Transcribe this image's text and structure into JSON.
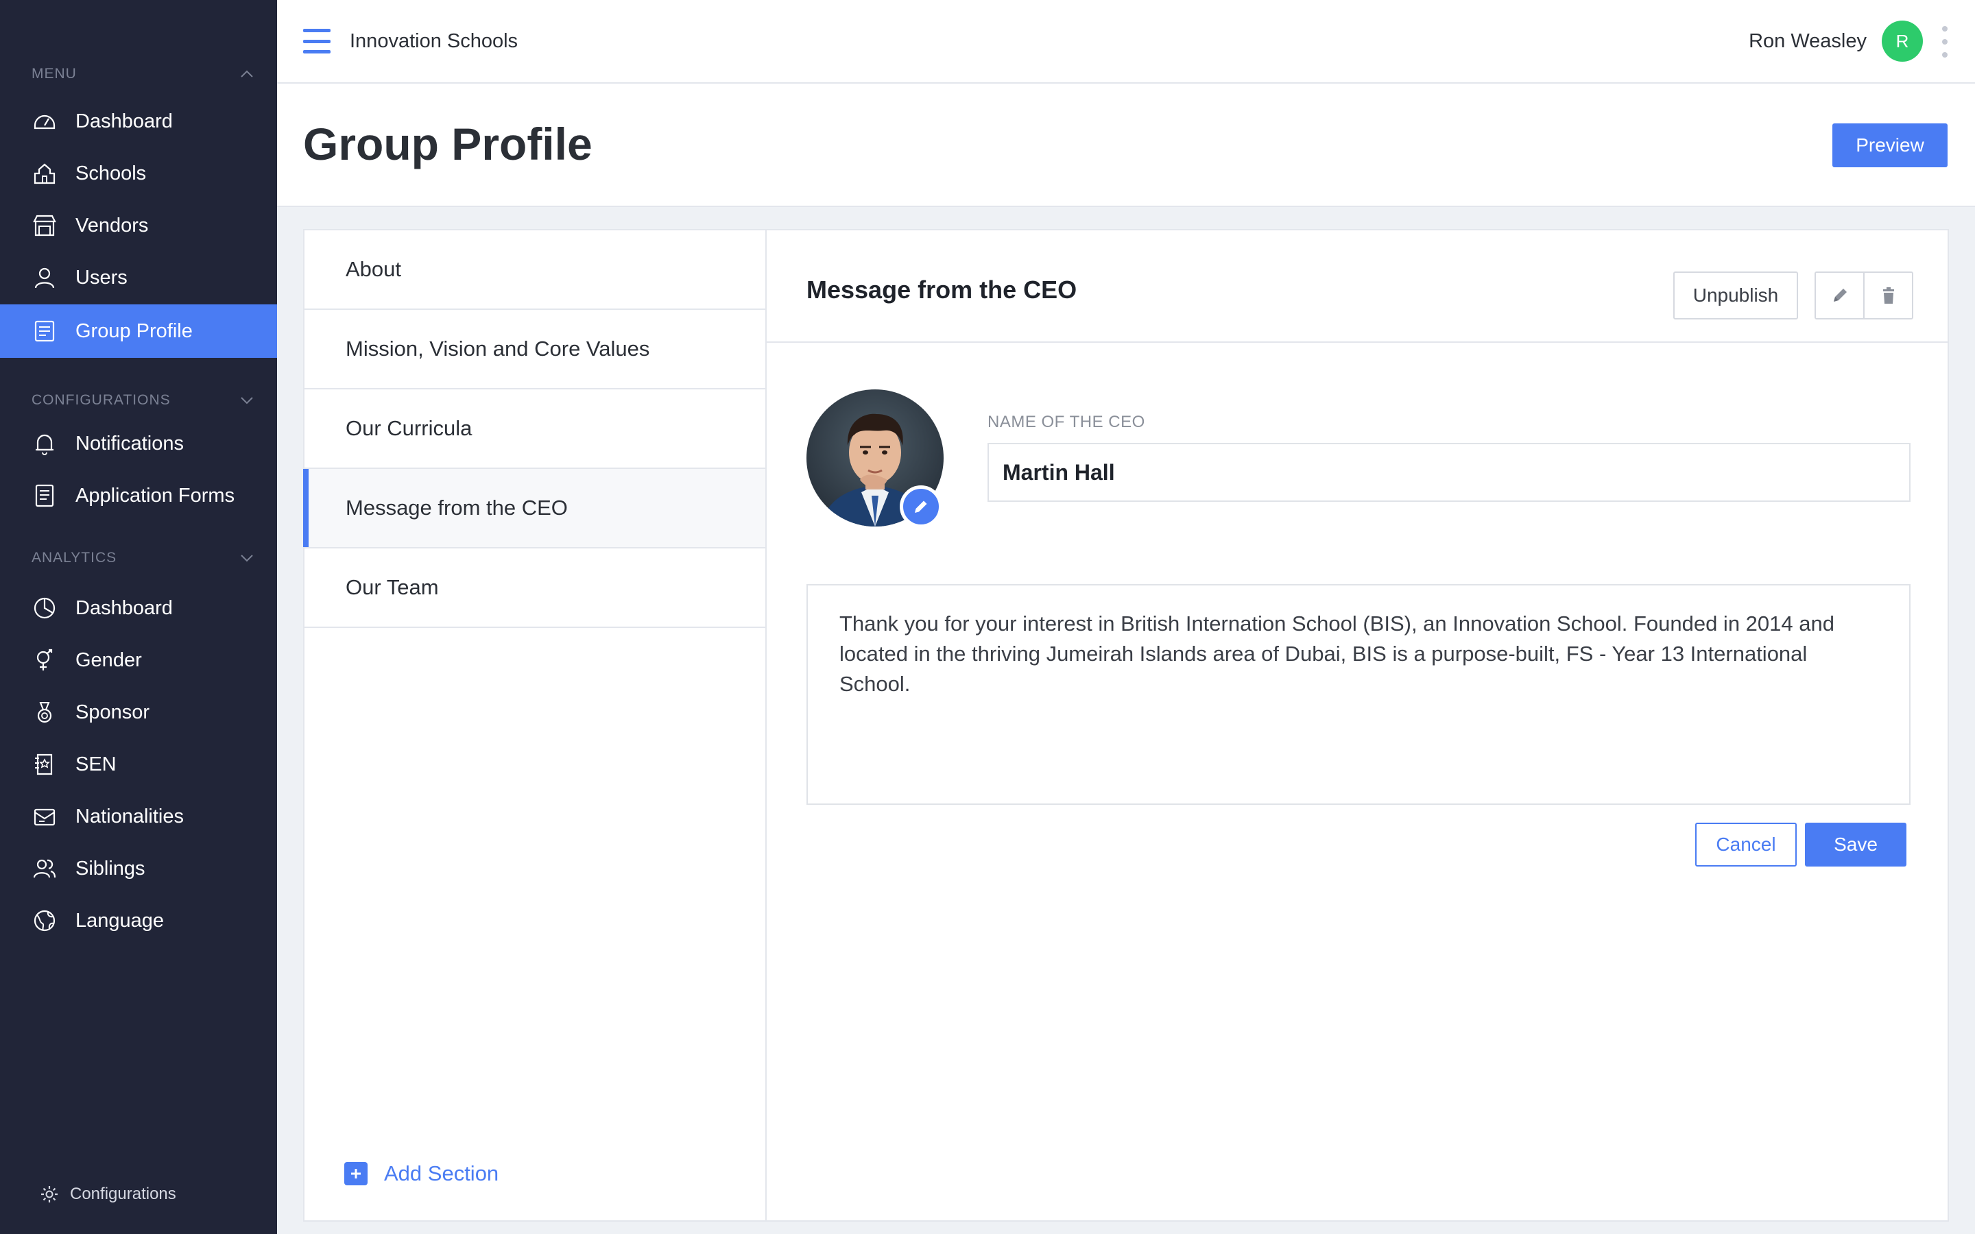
{
  "app": {
    "org_name": "Innovation Schools",
    "user_name": "Ron Weasley",
    "user_initial": "R",
    "accent_color": "#4a7cf3",
    "avatar_color": "#2dcb6b"
  },
  "sidebar": {
    "menu_heading": "MENU",
    "menu_items": [
      {
        "label": "Dashboard",
        "icon": "dashboard-icon"
      },
      {
        "label": "Schools",
        "icon": "school-icon"
      },
      {
        "label": "Vendors",
        "icon": "store-icon"
      },
      {
        "label": "Users",
        "icon": "user-icon"
      },
      {
        "label": "Group Profile",
        "icon": "profile-icon",
        "active": true
      }
    ],
    "config_heading": "CONFIGURATIONS",
    "config_items": [
      {
        "label": "Notifications",
        "icon": "bell-icon"
      },
      {
        "label": "Application Forms",
        "icon": "form-icon"
      }
    ],
    "analytics_heading": "ANALYTICS",
    "analytics_items": [
      {
        "label": "Dashboard",
        "icon": "pie-chart-icon"
      },
      {
        "label": "Gender",
        "icon": "gender-icon"
      },
      {
        "label": "Sponsor",
        "icon": "sponsor-icon"
      },
      {
        "label": "SEN",
        "icon": "sen-icon"
      },
      {
        "label": "Nationalities",
        "icon": "passport-icon"
      },
      {
        "label": "Siblings",
        "icon": "siblings-icon"
      },
      {
        "label": "Language",
        "icon": "globe-icon"
      }
    ],
    "footer_label": "Configurations"
  },
  "page": {
    "title": "Group Profile",
    "preview_label": "Preview"
  },
  "sections": {
    "items": [
      {
        "label": "About"
      },
      {
        "label": "Mission, Vision and Core Values"
      },
      {
        "label": "Our Curricula"
      },
      {
        "label": "Message from the CEO",
        "active": true
      },
      {
        "label": "Our Team"
      }
    ],
    "add_label": "Add Section"
  },
  "editor": {
    "title": "Message from the CEO",
    "unpublish_label": "Unpublish",
    "ceo_label": "NAME OF THE CEO",
    "ceo_name": "Martin Hall",
    "message": "Thank you for your interest in British Internation School (BIS), an Innovation School. Founded in 2014 and located in the thriving Jumeirah Islands area of Dubai, BIS is a purpose-built, FS - Year 13 International School.",
    "cancel_label": "Cancel",
    "save_label": "Save"
  }
}
